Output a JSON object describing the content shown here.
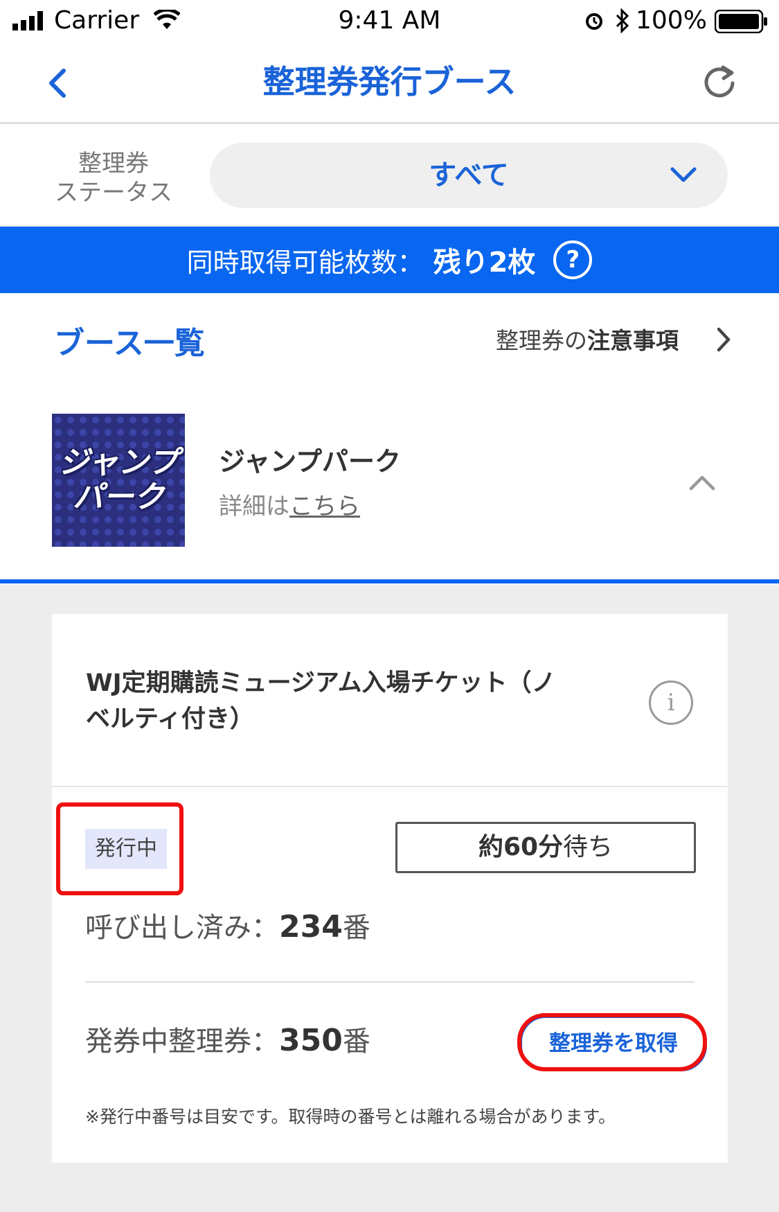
{
  "status_bar": {
    "carrier": "Carrier",
    "time": "9:41 AM",
    "battery": "100%"
  },
  "nav": {
    "title": "整理券発行ブース",
    "back_icon": "chevron-left-icon",
    "refresh_icon": "refresh-icon"
  },
  "filter": {
    "label_line1": "整理券",
    "label_line2": "ステータス",
    "value": "すべて"
  },
  "banner": {
    "label": "同時取得可能枚数：",
    "value": "残り2枚",
    "help_glyph": "?"
  },
  "list": {
    "title": "ブース一覧",
    "notice_prefix": "整理券の",
    "notice_strong": "注意事項"
  },
  "booth": {
    "logo_line1": "ジャンプ",
    "logo_line2": "パーク",
    "name": "ジャンプパーク",
    "detail_prefix": "詳細は",
    "detail_link": "こちら"
  },
  "ticket": {
    "title": "WJ定期購読ミュージアム入場チケット（ノベルティ付き）",
    "status_badge": "発行中",
    "wait_prefix": "約60分",
    "wait_suffix": "待ち",
    "called_label": "呼び出し済み：",
    "called_number": "234",
    "issuing_label": "発券中整理券：",
    "issuing_number": "350",
    "number_suffix": "番",
    "get_button": "整理券を取得",
    "footnote": "※発行中番号は目安です。取得時の番号とは離れる場合があります。"
  },
  "colors": {
    "accent": "#1a63d8",
    "banner": "#0866f0",
    "highlight": "#ef1010"
  }
}
